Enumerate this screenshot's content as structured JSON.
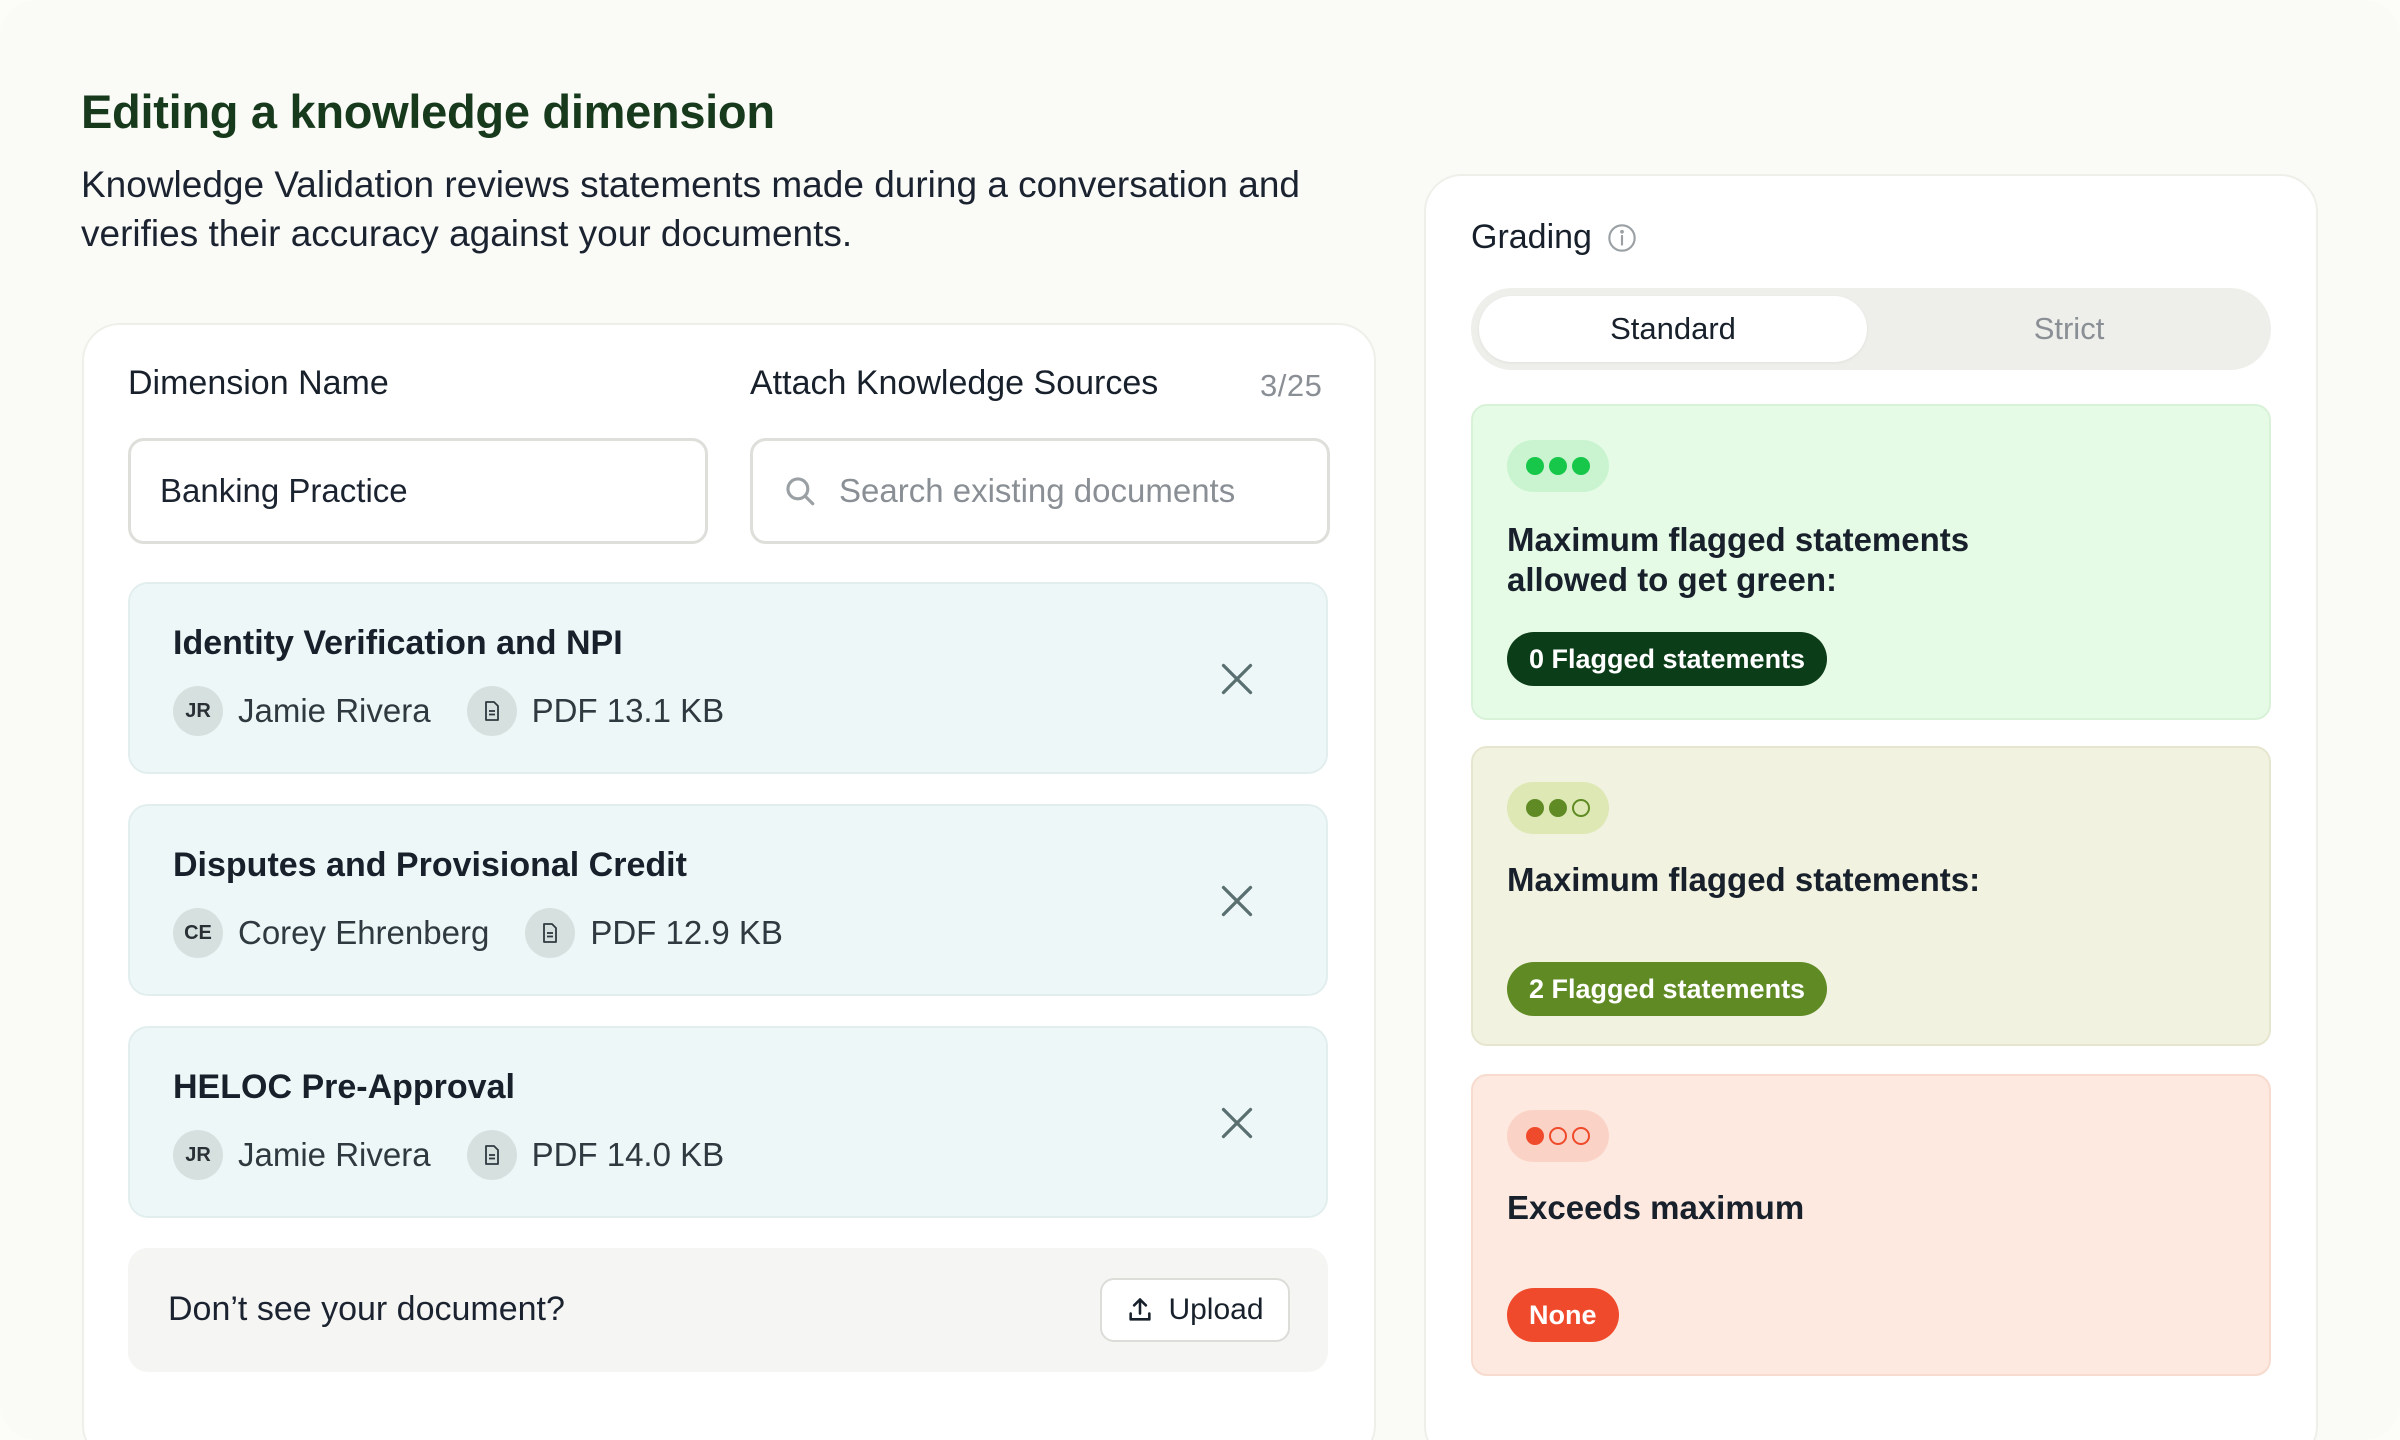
{
  "header": {
    "title": "Editing a knowledge dimension",
    "description": "Knowledge Validation reviews statements made during a conversation and verifies their accuracy against your documents."
  },
  "form": {
    "dimension_name_label": "Dimension Name",
    "dimension_name_value": "Banking Practice",
    "sources_label": "Attach Knowledge Sources",
    "sources_count": "3/25",
    "search_placeholder": "Search existing documents"
  },
  "documents": [
    {
      "title": "Identity Verification and NPI",
      "author_initials": "JR",
      "author": "Jamie Rivera",
      "file": "PDF 13.1 KB"
    },
    {
      "title": "Disputes and Provisional Credit",
      "author_initials": "CE",
      "author": "Corey Ehrenberg",
      "file": "PDF 12.9 KB"
    },
    {
      "title": "HELOC Pre-Approval",
      "author_initials": "JR",
      "author": "Jamie Rivera",
      "file": "PDF 14.0 KB"
    }
  ],
  "upload": {
    "prompt": "Don’t see your document?",
    "button_label": "Upload"
  },
  "grading": {
    "label": "Grading",
    "options": [
      "Standard",
      "Strict"
    ],
    "selected": "Standard",
    "levels": [
      {
        "title": "Maximum flagged statements allowed to get green:",
        "badge": "0 Flagged statements",
        "filled_dots": 3,
        "color": "#16c74a",
        "badge_color": "#0c3d19"
      },
      {
        "title": "Maximum flagged statements:",
        "badge": "2 Flagged statements",
        "filled_dots": 2,
        "color": "#5f8a24",
        "badge_color": "#5f8a24"
      },
      {
        "title": "Exceeds maximum",
        "badge": "None",
        "filled_dots": 1,
        "color": "#ef4a2b",
        "badge_color": "#ef4a2b"
      }
    ]
  },
  "colors": {
    "heading": "#173a1d",
    "doc_card_bg": "#eef7f7",
    "green_card_bg": "#e6fbe6",
    "olive_card_bg": "#f2f2e0",
    "red_card_bg": "#fde9e0"
  }
}
